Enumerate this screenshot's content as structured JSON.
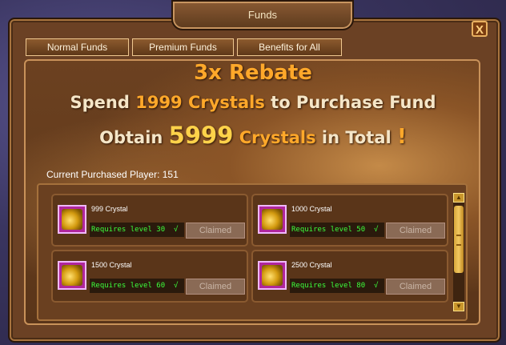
{
  "window": {
    "title": "Funds",
    "close_glyph": "X"
  },
  "tabs": [
    {
      "label": "Normal Funds"
    },
    {
      "label": "Premium Funds"
    },
    {
      "label": "Benefits for All"
    }
  ],
  "banner": {
    "headline": "3x Rebate",
    "line2_prefix": "Spend ",
    "line2_amount": "1999 Crystals",
    "line2_suffix": " to Purchase Fund",
    "line3_prefix": "Obtain ",
    "line3_amount": "5999",
    "line3_middle": " Crystals",
    "line3_suffix": " in Total ",
    "line3_exclaim": "!"
  },
  "players": {
    "label": "Current Purchased Player: 151"
  },
  "rewards": [
    {
      "name": "999 Crystal",
      "requirement": "Requires level 30",
      "check": "√",
      "button": "Claimed"
    },
    {
      "name": "1000 Crystal",
      "requirement": "Requires level 50",
      "check": "√",
      "button": "Claimed"
    },
    {
      "name": "1500 Crystal",
      "requirement": "Requires level 60",
      "check": "√",
      "button": "Claimed"
    },
    {
      "name": "2500 Crystal",
      "requirement": "Requires level 80",
      "check": "√",
      "button": "Claimed"
    }
  ],
  "icons": {
    "reward_icon": "crystal-coins-icon",
    "scroll_up": "scroll-up-arrow-icon",
    "scroll_down": "scroll-down-arrow-icon"
  },
  "colors": {
    "accent_orange": "#ffa82a",
    "accent_gold": "#ffd24a",
    "requirement_text": "#3cff3c"
  }
}
